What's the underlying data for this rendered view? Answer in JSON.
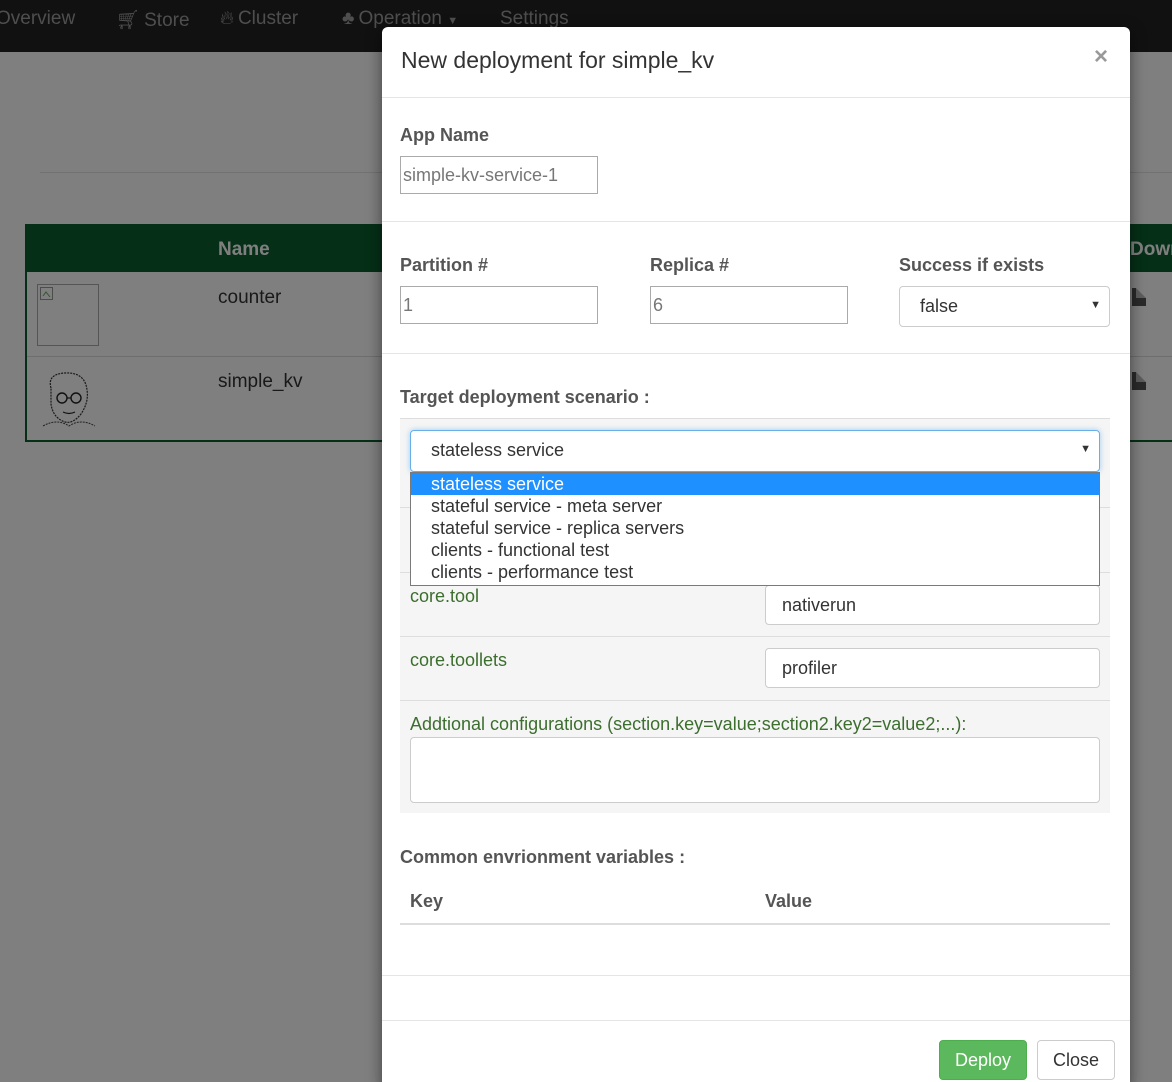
{
  "navbar": {
    "items": [
      {
        "label": "Overview",
        "icon": ""
      },
      {
        "label": "Store",
        "icon": "cart-icon"
      },
      {
        "label": "Cluster",
        "icon": "fire-icon"
      },
      {
        "label": "Operation",
        "icon": "tree-icon"
      },
      {
        "label": "Settings",
        "icon": ""
      }
    ]
  },
  "table": {
    "headers": {
      "name": "Name",
      "download": "Down"
    },
    "rows": [
      {
        "name": "counter"
      },
      {
        "name": "simple_kv"
      }
    ]
  },
  "modal": {
    "title": "New deployment for simple_kv",
    "close_glyph": "×",
    "app_name": {
      "label": "App Name",
      "value": "simple-kv-service-1"
    },
    "partition": {
      "label": "Partition #",
      "value": "1"
    },
    "replica": {
      "label": "Replica #",
      "value": "6"
    },
    "success_if_exists": {
      "label": "Success if exists",
      "selected": "false"
    },
    "scenario": {
      "label": "Target deployment scenario :",
      "selected": "stateless service",
      "options": [
        "stateless service",
        "stateful service - meta server",
        "stateful service - replica servers",
        "clients - functional test",
        "clients - performance test"
      ]
    },
    "config": {
      "tool_label": "core.tool",
      "tool_value": "nativerun",
      "toollets_label": "core.toollets",
      "toollets_value": "profiler",
      "additional_label": "Addtional configurations (section.key=value;section2.key2=value2;...):",
      "additional_value": ""
    },
    "env": {
      "label": "Common envrionment variables :",
      "key_header": "Key",
      "value_header": "Value"
    },
    "buttons": {
      "deploy": "Deploy",
      "close": "Close"
    }
  }
}
